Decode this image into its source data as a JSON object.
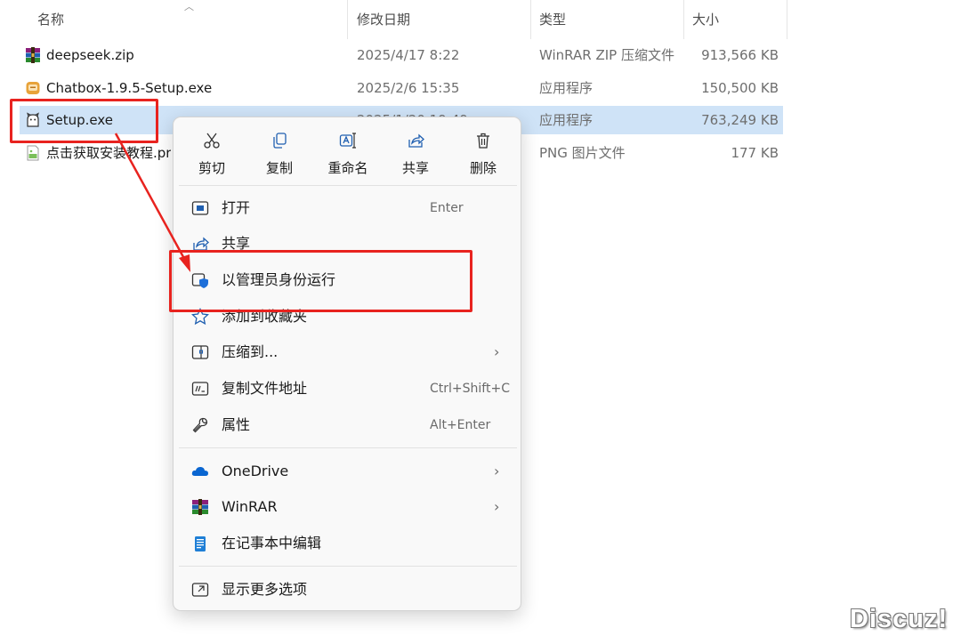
{
  "columns": {
    "name": "名称",
    "date": "修改日期",
    "type": "类型",
    "size": "大小"
  },
  "files": [
    {
      "name": "deepseek.zip",
      "date": "2025/4/17 8:22",
      "type": "WinRAR ZIP 压缩文件",
      "size": "913,566 KB",
      "icon": "winrar-icon",
      "selected": false
    },
    {
      "name": "Chatbox-1.9.5-Setup.exe",
      "date": "2025/2/6 15:35",
      "type": "应用程序",
      "size": "150,500 KB",
      "icon": "chatbox-app-icon",
      "selected": false
    },
    {
      "name": "Setup.exe",
      "date": "2025/1/20 19:49",
      "type": "应用程序",
      "size": "763,249 KB",
      "icon": "setup-app-icon",
      "selected": true
    },
    {
      "name": "点击获取安装教程.pr",
      "date": "",
      "type": "PNG 图片文件",
      "size": "177 KB",
      "icon": "png-image-icon",
      "selected": false
    }
  ],
  "context_menu": {
    "quick_actions": [
      {
        "label": "剪切",
        "icon": "cut-icon"
      },
      {
        "label": "复制",
        "icon": "copy-icon"
      },
      {
        "label": "重命名",
        "icon": "rename-icon"
      },
      {
        "label": "共享",
        "icon": "share-icon"
      },
      {
        "label": "删除",
        "icon": "delete-icon"
      }
    ],
    "items": [
      {
        "label": "打开",
        "shortcut": "Enter",
        "icon": "open-icon"
      },
      {
        "label": "共享",
        "shortcut": "",
        "icon": "share-icon"
      },
      {
        "label": "以管理员身份运行",
        "shortcut": "",
        "icon": "admin-shield-icon"
      },
      {
        "label": "添加到收藏夹",
        "shortcut": "",
        "icon": "star-icon"
      },
      {
        "label": "压缩到...",
        "shortcut": "",
        "icon": "zip-icon",
        "submenu": true
      },
      {
        "label": "复制文件地址",
        "shortcut": "Ctrl+Shift+C",
        "icon": "copy-path-icon"
      },
      {
        "label": "属性",
        "shortcut": "Alt+Enter",
        "icon": "wrench-icon"
      },
      {
        "label": "OneDrive",
        "shortcut": "",
        "icon": "onedrive-icon",
        "submenu": true
      },
      {
        "label": "WinRAR",
        "shortcut": "",
        "icon": "winrar-icon",
        "submenu": true
      },
      {
        "label": "在记事本中编辑",
        "shortcut": "",
        "icon": "notepad-icon"
      },
      {
        "label": "显示更多选项",
        "shortcut": "",
        "icon": "more-options-icon"
      }
    ],
    "chevron": "›"
  },
  "watermark": "Discuz!",
  "colors": {
    "selection": "#cfe3f7",
    "annotation_red": "#e8231f",
    "shield_blue": "#1e6fd9",
    "onedrive_blue": "#0a66d1"
  }
}
